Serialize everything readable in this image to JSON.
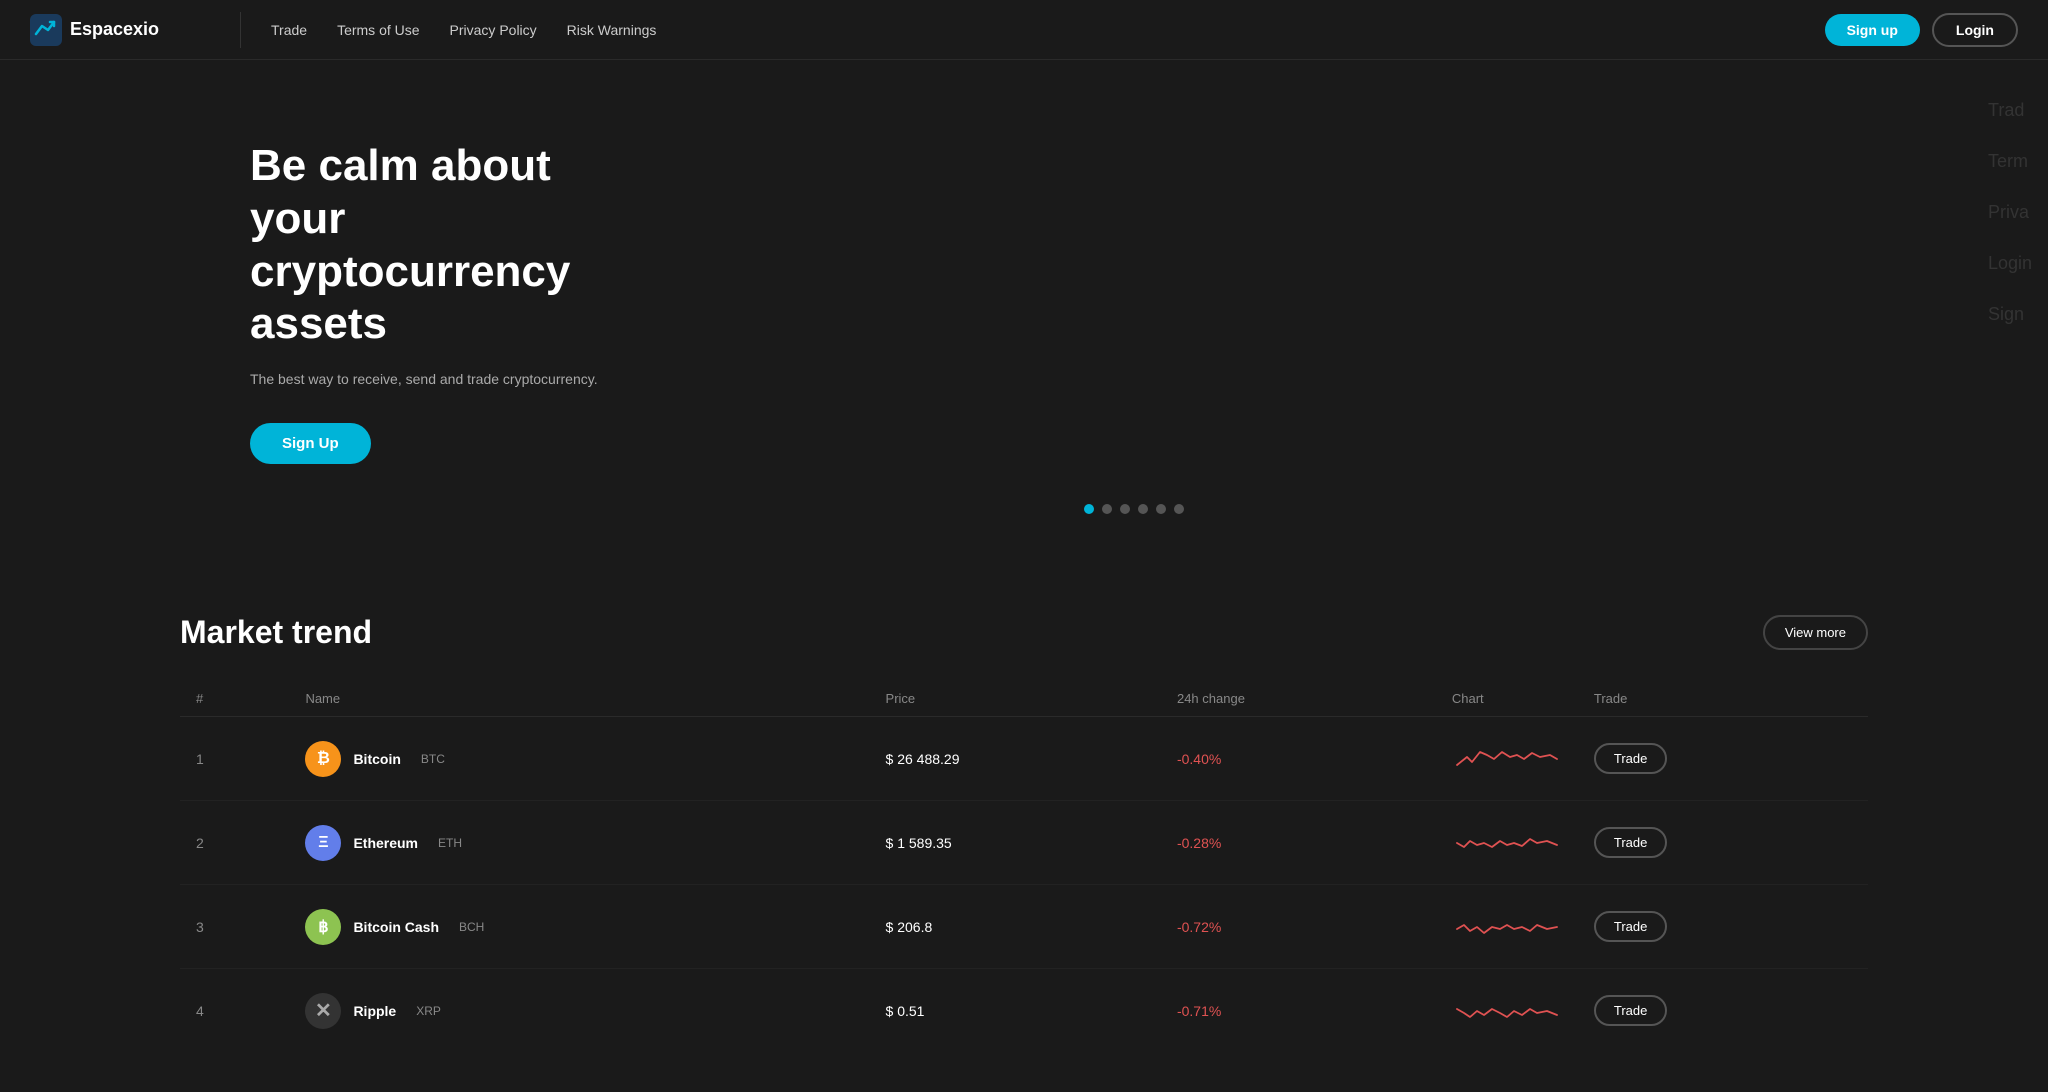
{
  "logo": {
    "text": "Espacexio"
  },
  "nav": {
    "trade": "Trade",
    "terms": "Terms of Use",
    "privacy": "Privacy Policy",
    "risk": "Risk Warnings",
    "signup": "Sign up",
    "login": "Login"
  },
  "hero": {
    "title": "Be calm about your cryptocurrency assets",
    "subtitle": "The best way to receive, send and trade cryptocurrency.",
    "cta": "Sign Up"
  },
  "carousel": {
    "dots": [
      true,
      false,
      false,
      false,
      false,
      false
    ]
  },
  "market": {
    "title": "Market trend",
    "view_more": "View more",
    "table": {
      "headers": [
        "#",
        "Name",
        "Price",
        "24h change",
        "Chart",
        "Trade"
      ],
      "rows": [
        {
          "num": "1",
          "coin": "Bitcoin",
          "ticker": "BTC",
          "price": "$ 26 488.29",
          "change": "-0.40%",
          "trade": "Trade",
          "icon_type": "btc",
          "icon_label": "₿"
        },
        {
          "num": "2",
          "coin": "Ethereum",
          "ticker": "ETH",
          "price": "$ 1 589.35",
          "change": "-0.28%",
          "trade": "Trade",
          "icon_type": "eth",
          "icon_label": "Ξ"
        },
        {
          "num": "3",
          "coin": "Bitcoin Cash",
          "ticker": "BCH",
          "price": "$ 206.8",
          "change": "-0.72%",
          "trade": "Trade",
          "icon_type": "bch",
          "icon_label": "฿"
        },
        {
          "num": "4",
          "coin": "Ripple",
          "ticker": "XRP",
          "price": "$ 0.51",
          "change": "-0.71%",
          "trade": "Trade",
          "icon_type": "xrp",
          "icon_label": "✕"
        }
      ]
    }
  },
  "right_overlay": {
    "items": [
      "Trad",
      "Term",
      "Priva",
      "Login",
      "Sign"
    ]
  },
  "colors": {
    "accent": "#00b4d8",
    "negative": "#e05252",
    "bg": "#1a1a1a"
  }
}
